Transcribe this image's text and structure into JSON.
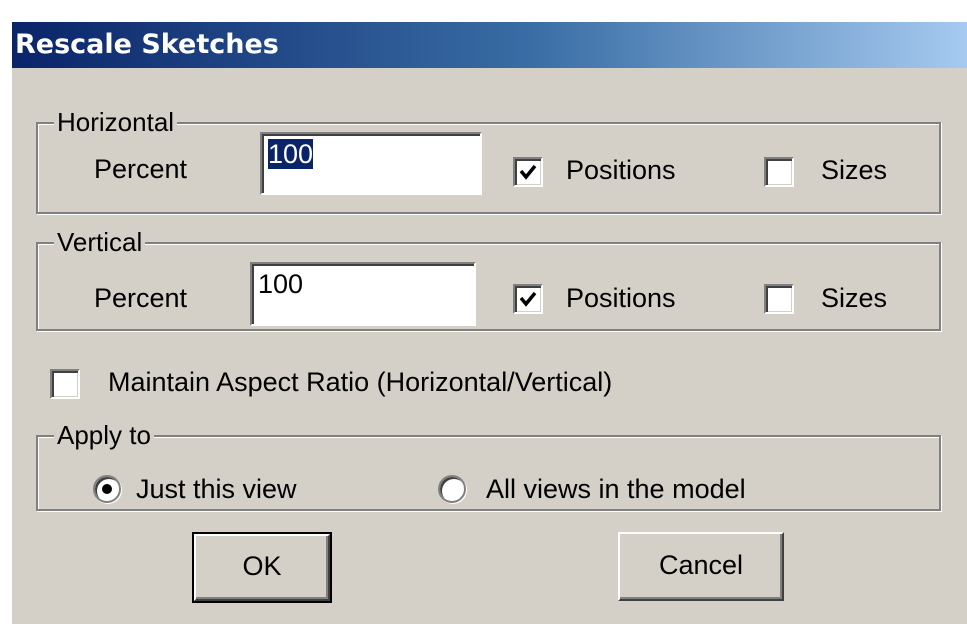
{
  "dialog": {
    "title": "Rescale Sketches"
  },
  "horizontal": {
    "legend": "Horizontal",
    "percent_label": "Percent",
    "percent_value": "100",
    "positions_label": "Positions",
    "positions_checked": true,
    "sizes_label": "Sizes",
    "sizes_checked": false
  },
  "vertical": {
    "legend": "Vertical",
    "percent_label": "Percent",
    "percent_value": "100",
    "positions_label": "Positions",
    "positions_checked": true,
    "sizes_label": "Sizes",
    "sizes_checked": false
  },
  "aspect": {
    "label": "Maintain Aspect Ratio (Horizontal/Vertical)",
    "checked": false
  },
  "apply_to": {
    "legend": "Apply to",
    "just_this_view": "Just this view",
    "all_views": "All views in the model",
    "selected": "just_this_view"
  },
  "buttons": {
    "ok": "OK",
    "cancel": "Cancel"
  },
  "colors": {
    "face": "#d4d0c8",
    "title_start": "#0a246a",
    "title_end": "#a6caf0",
    "selection": "#0a246a"
  }
}
